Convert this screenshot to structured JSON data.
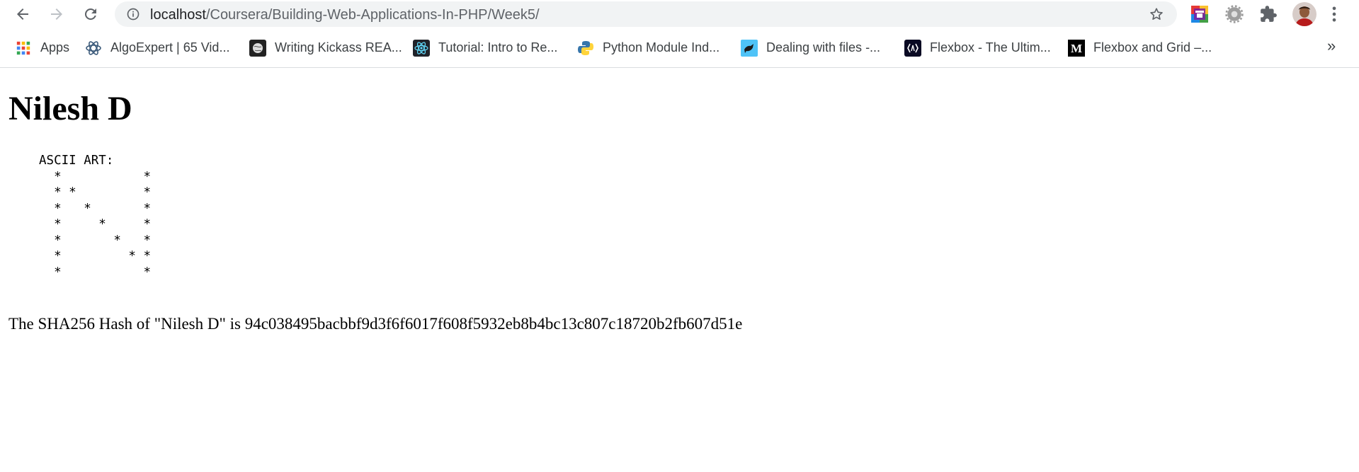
{
  "browser": {
    "url_host": "localhost",
    "url_path": "/Coursera/Building-Web-Applications-In-PHP/Week5/",
    "icons": [
      "back-icon",
      "forward-icon",
      "reload-icon",
      "info-icon",
      "star-icon",
      "extension-icon",
      "settings-gear-icon",
      "puzzle-icon",
      "avatar",
      "kebab-menu-icon"
    ]
  },
  "bookmarks": [
    {
      "label": "Apps",
      "icon": "apps-grid-icon"
    },
    {
      "label": "AlgoExpert | 65 Vid...",
      "icon": "algoexpert-icon"
    },
    {
      "label": "Writing Kickass REA...",
      "icon": "globe-icon"
    },
    {
      "label": "Tutorial: Intro to Re...",
      "icon": "react-icon"
    },
    {
      "label": "Python Module Ind...",
      "icon": "python-icon"
    },
    {
      "label": "Dealing with files -...",
      "icon": "file-icon"
    },
    {
      "label": "Flexbox - The Ultim...",
      "icon": "flexbox-icon"
    },
    {
      "label": "Flexbox and Grid –...",
      "icon": "medium-icon"
    }
  ],
  "bookmarks_more": "»",
  "page": {
    "title": "Nilesh D",
    "ascii_art": "ASCII ART:\n  *           *\n  * *         *\n  *   *       *\n  *     *     *\n  *       *   *\n  *         * *\n  *           *",
    "hash_text": "The SHA256 Hash of \"Nilesh D\" is 94c038495bacbbf9d3f6f6017f608f5932eb8b4bc13c807c18720b2fb607d51e"
  }
}
